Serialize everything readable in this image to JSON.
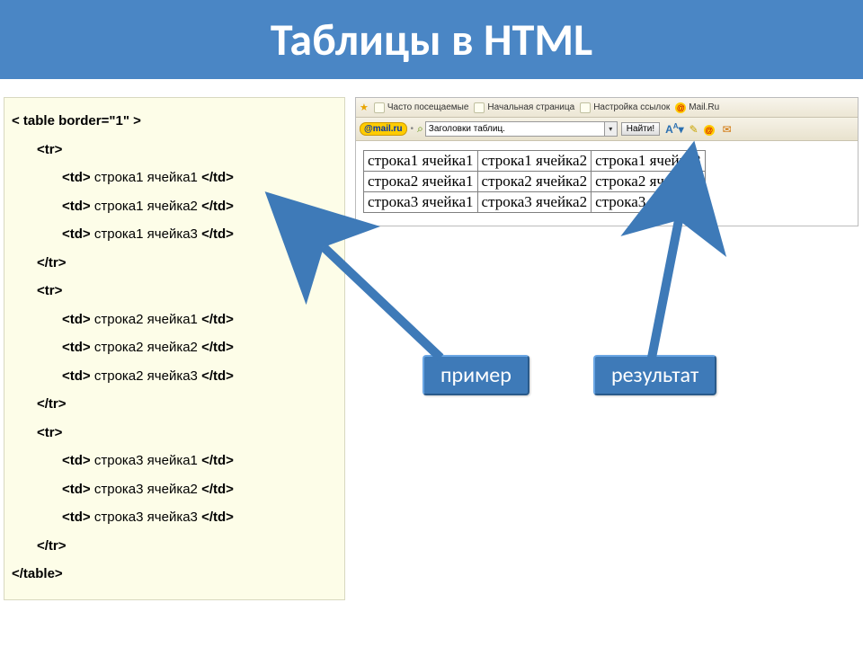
{
  "title": "Таблицы в HTML",
  "code": {
    "open": "< table border=\"1\" >",
    "tr_open": "<tr>",
    "tr_close": "</tr>",
    "close": "</table>",
    "td_prefix": "<td> ",
    "td_suffix": " </td>",
    "cells": {
      "r1c1": "строка1 ячейка1",
      "r1c2": "строка1 ячейка2",
      "r1c3": "строка1 ячейка3",
      "r2c1": "строка2 ячейка1",
      "r2c2": "строка2 ячейка2",
      "r2c3": "строка2 ячейка3",
      "r3c1": "строка3 ячейка1",
      "r3c2": "строка3 ячейка2",
      "r3c3": "строка3 ячейка3"
    }
  },
  "bookmarks": {
    "freq": "Часто посещаемые",
    "home": "Начальная страница",
    "links": "Настройка ссылок",
    "mailru": "Mail.Ru"
  },
  "search": {
    "logo": "@mail.ru",
    "value": "Заголовки таблиц.",
    "button": "Найти!",
    "font_ico": "A",
    "font_sup": "A"
  },
  "table": {
    "r1": {
      "c1": "строка1 ячейка1",
      "c2": "строка1 ячейка2",
      "c3": "строка1 ячейка3"
    },
    "r2": {
      "c1": "строка2 ячейка1",
      "c2": "строка2 ячейка2",
      "c3": "строка2 ячейка3"
    },
    "r3": {
      "c1": "строка3 ячейка1",
      "c2": "строка3 ячейка2",
      "c3": "строка3 ячейка3"
    }
  },
  "labels": {
    "primer": "пример",
    "result": "результат"
  }
}
